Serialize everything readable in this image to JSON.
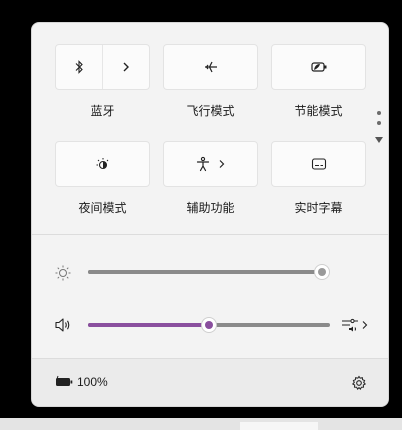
{
  "colors": {
    "accent": "#8a4f9e",
    "panel_bg": "#f3f3f3",
    "tile_bg": "#fbfbfb"
  },
  "quick_settings": [
    {
      "id": "bluetooth",
      "label": "蓝牙",
      "icon": "bluetooth-icon"
    },
    {
      "id": "airplane",
      "label": "飞行模式",
      "icon": "airplane-icon"
    },
    {
      "id": "battery-saver",
      "label": "节能模式",
      "icon": "battery-saver-icon"
    },
    {
      "id": "night-light",
      "label": "夜间模式",
      "icon": "night-light-icon"
    },
    {
      "id": "accessibility",
      "label": "辅助功能",
      "icon": "accessibility-icon"
    },
    {
      "id": "live-captions",
      "label": "实时字幕",
      "icon": "captions-icon"
    }
  ],
  "brightness": {
    "icon": "brightness-icon",
    "value": 100
  },
  "volume": {
    "icon": "speaker-icon",
    "value": 50
  },
  "footer": {
    "battery_percent": "100%"
  }
}
